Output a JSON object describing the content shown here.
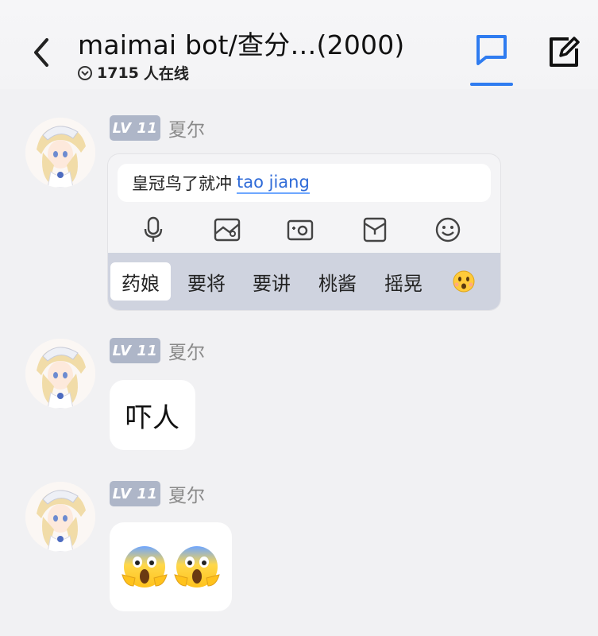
{
  "header": {
    "title": "maimai bot/查分…(2000)",
    "online_count": "1715",
    "online_label": "人在线"
  },
  "messages": [
    {
      "level": "LV 11",
      "sender": "夏尔",
      "type": "screenshot",
      "card": {
        "input_prefix": "皇冠鸟了就冲",
        "input_typed": "tao jiang",
        "candidates": [
          "药娘",
          "要将",
          "要讲",
          "桃酱",
          "摇晃"
        ]
      }
    },
    {
      "level": "LV 11",
      "sender": "夏尔",
      "type": "text",
      "text": "吓人"
    },
    {
      "level": "LV 11",
      "sender": "夏尔",
      "type": "emoji",
      "emojis": [
        "screaming-face",
        "screaming-face"
      ]
    }
  ],
  "icons": {
    "back": "chevron-left-icon",
    "chat": "chat-bubble-icon",
    "compose": "edit-icon"
  },
  "colors": {
    "accent": "#2f7cf0",
    "level_badge": "#aeb6c8",
    "background": "#f1f1f3"
  }
}
